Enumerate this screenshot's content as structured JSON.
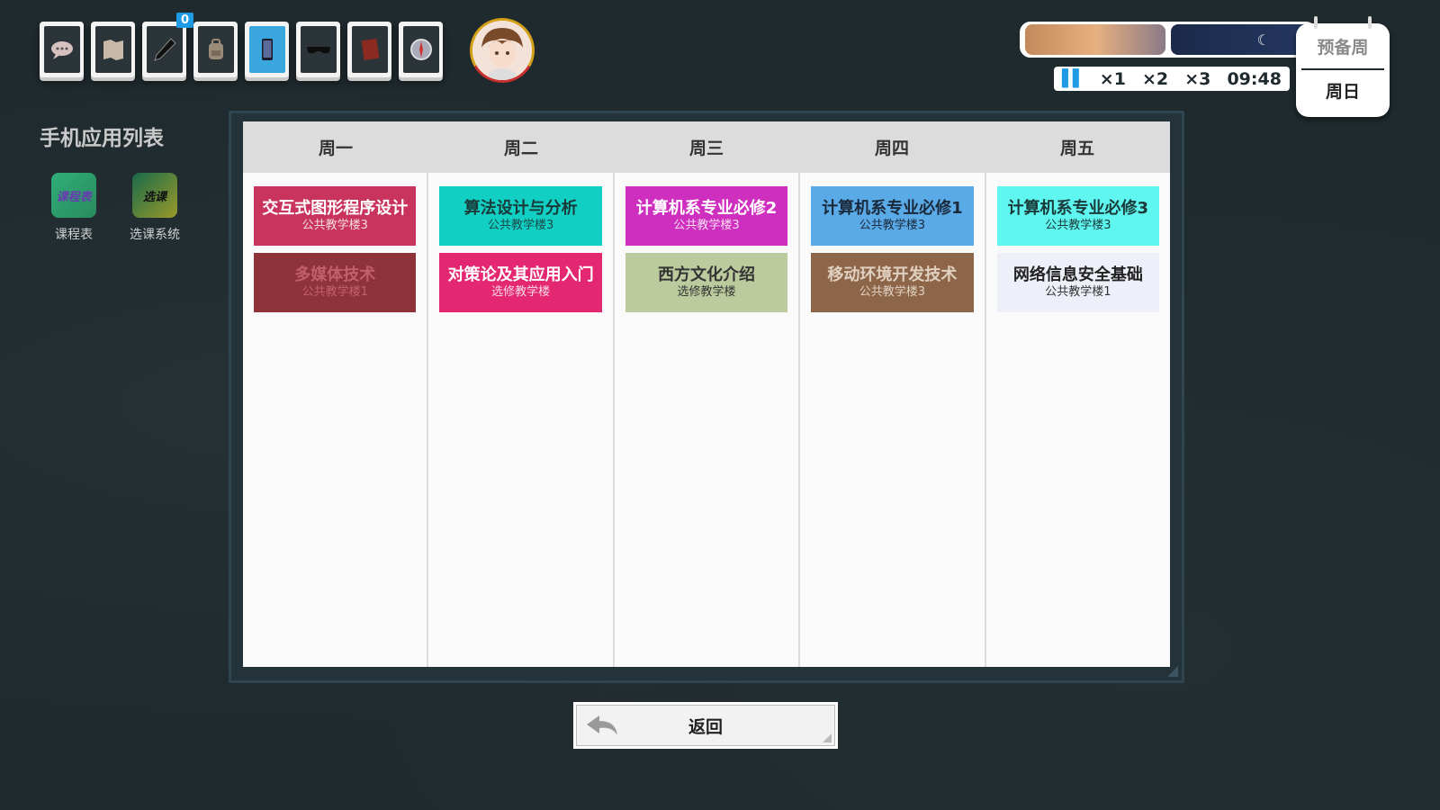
{
  "toolbar": {
    "items": [
      {
        "icon": "chat-bubble-icon",
        "active": false
      },
      {
        "icon": "map-icon",
        "active": false
      },
      {
        "icon": "pen-icon",
        "active": false,
        "badge": "0"
      },
      {
        "icon": "backpack-icon",
        "active": false
      },
      {
        "icon": "phone-icon",
        "active": true
      },
      {
        "icon": "sunglasses-icon",
        "active": false
      },
      {
        "icon": "book-icon",
        "active": false
      },
      {
        "icon": "compass-icon",
        "active": false
      }
    ]
  },
  "time": {
    "speeds": [
      "×1",
      "×2",
      "×3"
    ],
    "clock": "09:48",
    "week_label": "预备周",
    "day_label": "周日"
  },
  "apps": {
    "title": "手机应用列表",
    "items": [
      {
        "icon_text": "课程表",
        "label": "课程表",
        "color": "#2e9e6a"
      },
      {
        "icon_text": "选课",
        "label": "选课系统",
        "color": "#3a7a3a"
      }
    ]
  },
  "schedule": {
    "days": [
      "周一",
      "周二",
      "周三",
      "周四",
      "周五"
    ],
    "columns": [
      [
        {
          "name": "交互式图形程序设计",
          "location": "公共教学楼3",
          "bg": "#c8345e",
          "fg": "#ffffff",
          "loc_fg": "#f5d9e0"
        },
        {
          "name": "多媒体技术",
          "location": "公共教学楼1",
          "bg": "#8f333b",
          "fg": "#c2606a",
          "loc_fg": "#c2606a"
        }
      ],
      [
        {
          "name": "算法设计与分析",
          "location": "公共教学楼3",
          "bg": "#11cfc3",
          "fg": "#1a3a3a",
          "loc_fg": "#1a4a4a"
        },
        {
          "name": "对策论及其应用入门",
          "location": "选修教学楼",
          "bg": "#e32770",
          "fg": "#ffffff",
          "loc_fg": "#f9d8e4"
        }
      ],
      [
        {
          "name": "计算机系专业必修2",
          "location": "公共教学楼3",
          "bg": "#cf2fbf",
          "fg": "#ffffff",
          "loc_fg": "#f7dcf3"
        },
        {
          "name": "西方文化介绍",
          "location": "选修教学楼",
          "bg": "#bccb9e",
          "fg": "#333333",
          "loc_fg": "#333333"
        }
      ],
      [
        {
          "name": "计算机系专业必修1",
          "location": "公共教学楼3",
          "bg": "#5aaae8",
          "fg": "#1a2a3a",
          "loc_fg": "#1a2a3a"
        },
        {
          "name": "移动环境开发技术",
          "location": "公共教学楼3",
          "bg": "#8d6549",
          "fg": "#e0d0c0",
          "loc_fg": "#e0d0c0"
        }
      ],
      [
        {
          "name": "计算机系专业必修3",
          "location": "公共教学楼3",
          "bg": "#5ff6f0",
          "fg": "#1a3a3a",
          "loc_fg": "#1a3a3a"
        },
        {
          "name": "网络信息安全基础",
          "location": "公共教学楼1",
          "bg": "#edf0f8",
          "fg": "#222222",
          "loc_fg": "#333333"
        }
      ]
    ]
  },
  "back_button": {
    "label": "返回",
    "icon": "return-arrow-icon"
  }
}
